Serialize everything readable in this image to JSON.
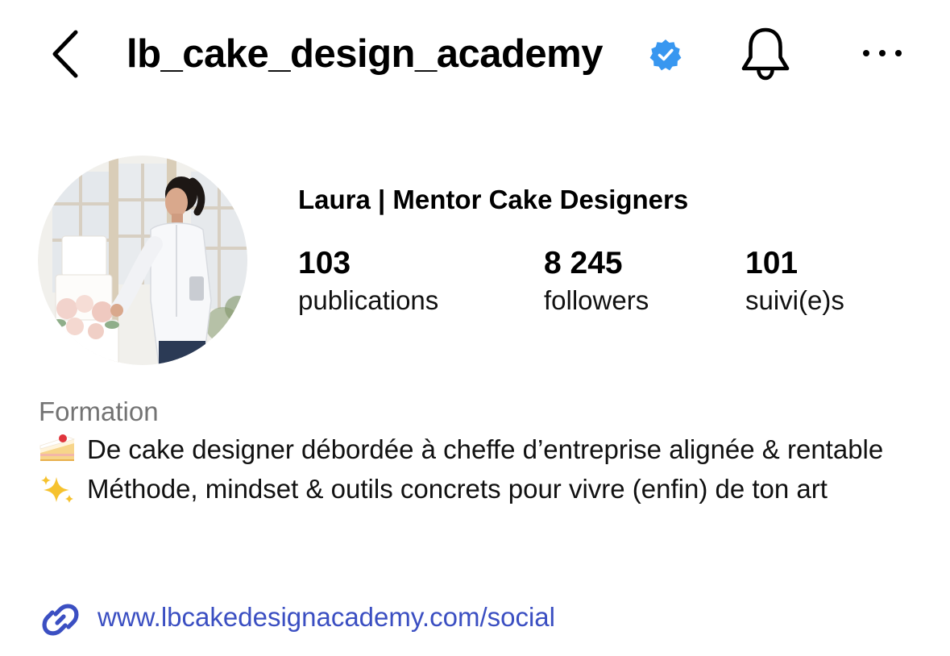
{
  "header": {
    "username": "lb_cake_design_academy",
    "verified": true,
    "icons": [
      "chevron-left-icon",
      "verified-badge-icon",
      "bell-icon",
      "more-icon"
    ]
  },
  "profile": {
    "display_name": "Laura | Mentor Cake Designers",
    "stats": {
      "posts": {
        "count": "103",
        "label": "publications"
      },
      "followers": {
        "count": "8 245",
        "label": "followers"
      },
      "following": {
        "count": "101",
        "label": "suivi(e)s"
      }
    }
  },
  "bio": {
    "category": "Formation",
    "line1_emoji": "cake-slice-emoji",
    "line1": "De cake designer débordée à cheffe d’entreprise alignée & rentable",
    "line2_emoji": "sparkles-emoji",
    "line2": "Méthode, mindset & outils concrets pour vivre (enfin) de ton art",
    "link": "www.lbcakedesignacademy.com/social"
  },
  "colors": {
    "verified_blue": "#3897f0",
    "link_blue": "#3b4fc2",
    "secondary_text": "#737373"
  }
}
